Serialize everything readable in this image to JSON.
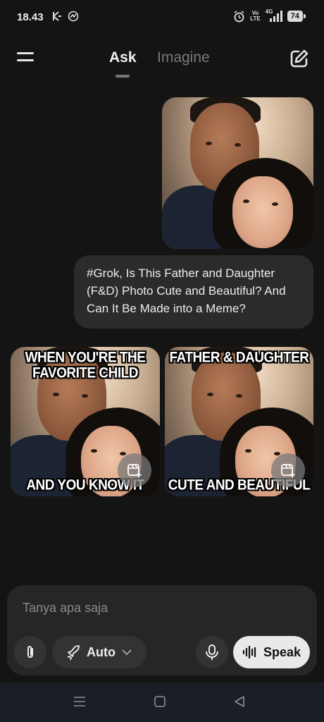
{
  "status": {
    "time": "18.43",
    "volte_top": "Vo",
    "volte_bottom": "LTE",
    "network": "4G",
    "battery": "74"
  },
  "header": {
    "tabs": [
      {
        "label": "Ask",
        "active": true
      },
      {
        "label": "Imagine",
        "active": false
      }
    ]
  },
  "messages": {
    "user_text": "#Grok, Is This Father and Daughter (F&D) Photo Cute and Beautiful? And Can It Be Made into a Meme?",
    "memes": [
      {
        "top_line1": "WHEN YOU'RE THE",
        "top_line2": "FAVORITE CHILD",
        "bottom": "AND YOU KNOW IT"
      },
      {
        "top_line1": "FATHER & DAUGHTER",
        "top_line2": "",
        "bottom": "CUTE AND BEAUTIFUL"
      }
    ]
  },
  "composer": {
    "placeholder": "Tanya apa saja",
    "mode_label": "Auto",
    "speak_label": "Speak"
  },
  "icons": [
    "menu-icon",
    "edit-icon",
    "paperclip-icon",
    "rocket-icon",
    "chevron-down-icon",
    "mic-icon",
    "waveform-icon",
    "image-add-icon"
  ],
  "colors": {
    "background": "#141414",
    "bubble": "#2b2b2b",
    "composer": "#262626",
    "speak_button": "#e9e9e9"
  }
}
